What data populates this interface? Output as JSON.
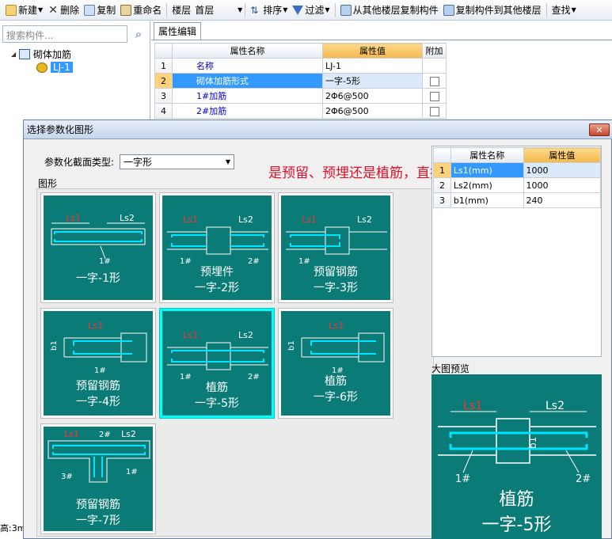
{
  "toolbar": {
    "new": "新建",
    "delete": "删除",
    "copy": "复制",
    "rename": "重命名",
    "floor_label": "楼层",
    "floor_value": "首层",
    "sort": "排序",
    "filter": "过滤",
    "copy_from_floor": "从其他楼层复制构件",
    "copy_to_floor": "复制构件到其他楼层",
    "find": "查找"
  },
  "left_panel": {
    "search_placeholder": "搜索构件...",
    "tree_root": "砌体加筋",
    "tree_child": "LJ-1",
    "status": "高:3m"
  },
  "property_editor": {
    "tab": "属性编辑",
    "col_name": "属性名称",
    "col_value": "属性值",
    "col_extra": "附加",
    "rows": [
      {
        "n": "1",
        "name": "名称",
        "value": "LJ-1"
      },
      {
        "n": "2",
        "name": "砌体加筋形式",
        "value": "一字-5形"
      },
      {
        "n": "3",
        "name": "1#加筋",
        "value": "2Φ6@500"
      },
      {
        "n": "4",
        "name": "2#加筋",
        "value": "2Φ6@500"
      }
    ]
  },
  "dialog": {
    "title": "选择参数化图形",
    "close": "✕",
    "section_type_label": "参数化截面类型:",
    "section_type_value": "一字形",
    "shapes_label": "图形",
    "annotation": "是预留、预埋还是植筋，直接选就可以了",
    "shapes": [
      {
        "line1": "",
        "line2": "一字-1形"
      },
      {
        "line1": "预埋件",
        "line2": "一字-2形"
      },
      {
        "line1": "预留钢筋",
        "line2": "一字-3形"
      },
      {
        "line1": "预留钢筋",
        "line2": "一字-4形"
      },
      {
        "line1": "植筋",
        "line2": "一字-5形"
      },
      {
        "line1": "植筋",
        "line2": "一字-6形"
      },
      {
        "line1": "预留钢筋",
        "line2": "一字-7形"
      }
    ],
    "params": {
      "col_name": "属性名称",
      "col_value": "属性值",
      "rows": [
        {
          "n": "1",
          "name": "Ls1(mm)",
          "value": "1000"
        },
        {
          "n": "2",
          "name": "Ls2(mm)",
          "value": "1000"
        },
        {
          "n": "3",
          "name": "b1(mm)",
          "value": "240"
        }
      ]
    },
    "preview_label": "大图预览",
    "preview_line1": "植筋",
    "preview_line2": "一字-5形"
  },
  "drawing_labels": {
    "ls1": "Ls1",
    "ls2": "Ls2",
    "b1": "b1",
    "bar1": "1#",
    "bar2": "2#",
    "bar3": "3#"
  },
  "colors": {
    "card_bg": "#0b7b77",
    "rebar": "#00e5ff",
    "dim_red": "#ff3030",
    "selected": "#00ffff",
    "annotation": "#e0102a"
  }
}
